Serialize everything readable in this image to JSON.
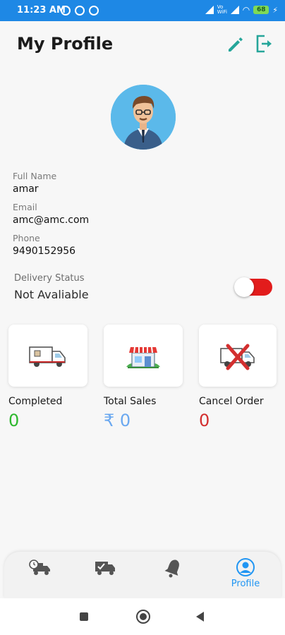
{
  "status_bar": {
    "time": "11:23 AM",
    "network_label": "Vo WiFi",
    "battery": "68",
    "bg_color": "#1e88e5"
  },
  "header": {
    "title": "My Profile",
    "edit_icon": "pencil-icon",
    "logout_icon": "logout-icon",
    "accent_color": "#26a69a"
  },
  "profile": {
    "fields": [
      {
        "label": "Full Name",
        "value": "amar"
      },
      {
        "label": "Email",
        "value": "amc@amc.com"
      },
      {
        "label": "Phone",
        "value": "9490152956"
      }
    ],
    "delivery": {
      "label": "Delivery Status",
      "value": "Not Avaliable",
      "toggle_on": false,
      "toggle_color": "#e21c1c"
    }
  },
  "stats": [
    {
      "label": "Completed",
      "value": "0",
      "color": "#2eb82e",
      "icon": "delivery-truck-icon"
    },
    {
      "label": "Total Sales",
      "value": "₹ 0",
      "color": "#6aa8f0",
      "icon": "shop-icon"
    },
    {
      "label": "Cancel Order",
      "value": "0",
      "color": "#d32f2f",
      "icon": "cancel-truck-icon"
    }
  ],
  "bottom_nav": {
    "items": [
      {
        "icon": "fast-delivery-icon",
        "label": ""
      },
      {
        "icon": "truck-check-icon",
        "label": ""
      },
      {
        "icon": "bell-icon",
        "label": ""
      },
      {
        "icon": "profile-icon",
        "label": "Profile",
        "active": true
      }
    ],
    "active_color": "#2196f3"
  },
  "system_nav": {
    "buttons": [
      "recents-button",
      "home-button",
      "back-button"
    ]
  }
}
